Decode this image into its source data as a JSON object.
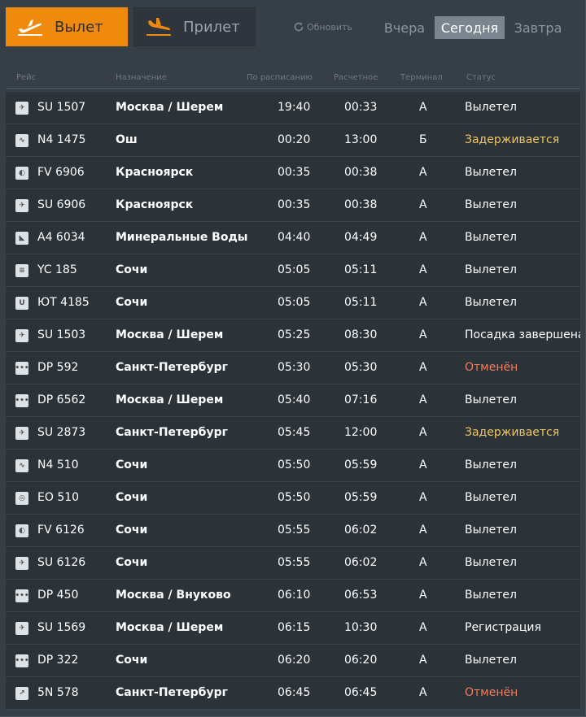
{
  "header": {
    "departures_label": "Вылет",
    "arrivals_label": "Прилет",
    "refresh_label": "Обновить",
    "days": {
      "yesterday": "Вчера",
      "today": "Сегодня",
      "tomorrow": "Завтра"
    }
  },
  "columns": {
    "flight": "Рейс",
    "destination": "Назначение",
    "scheduled": "По расписанию",
    "estimated": "Расчетное",
    "terminal": "Терминал",
    "status": "Статус"
  },
  "colors": {
    "accent": "#f08a0d",
    "delayed": "#f0c75e",
    "cancelled": "#f07e5f",
    "normal": "#ffffff"
  },
  "flights": [
    {
      "airline_icon": "aeroflot-logo-icon",
      "flight": "SU 1507",
      "destination": "Москва / Шерем",
      "scheduled": "19:40",
      "estimated": "00:33",
      "terminal": "A",
      "status": "Вылетел",
      "status_type": "normal"
    },
    {
      "airline_icon": "nordwind-logo-icon",
      "flight": "N4 1475",
      "destination": "Ош",
      "scheduled": "00:20",
      "estimated": "13:00",
      "terminal": "Б",
      "status": "Задерживается",
      "status_type": "delayed"
    },
    {
      "airline_icon": "rossiya-logo-icon",
      "flight": "FV 6906",
      "destination": "Красноярск",
      "scheduled": "00:35",
      "estimated": "00:38",
      "terminal": "A",
      "status": "Вылетел",
      "status_type": "normal"
    },
    {
      "airline_icon": "aeroflot-logo-icon",
      "flight": "SU 6906",
      "destination": "Красноярск",
      "scheduled": "00:35",
      "estimated": "00:38",
      "terminal": "A",
      "status": "Вылетел",
      "status_type": "normal"
    },
    {
      "airline_icon": "aurora-logo-icon",
      "flight": "A4 6034",
      "destination": "Минеральные Воды",
      "scheduled": "04:40",
      "estimated": "04:49",
      "terminal": "A",
      "status": "Вылетел",
      "status_type": "normal"
    },
    {
      "airline_icon": "yamal-logo-icon",
      "flight": "YC 185",
      "destination": "Сочи",
      "scheduled": "05:05",
      "estimated": "05:11",
      "terminal": "A",
      "status": "Вылетел",
      "status_type": "normal"
    },
    {
      "airline_icon": "utair-logo-icon",
      "flight": "ЮТ 4185",
      "destination": "Сочи",
      "scheduled": "05:05",
      "estimated": "05:11",
      "terminal": "A",
      "status": "Вылетел",
      "status_type": "normal"
    },
    {
      "airline_icon": "aeroflot-logo-icon",
      "flight": "SU 1503",
      "destination": "Москва / Шерем",
      "scheduled": "05:25",
      "estimated": "08:30",
      "terminal": "A",
      "status": "Посадка завершена",
      "status_type": "normal"
    },
    {
      "airline_icon": "pobeda-logo-icon",
      "flight": "DP 592",
      "destination": "Санкт-Петербург",
      "scheduled": "05:30",
      "estimated": "05:30",
      "terminal": "A",
      "status": "Отменён",
      "status_type": "cancelled"
    },
    {
      "airline_icon": "pobeda-logo-icon",
      "flight": "DP 6562",
      "destination": "Москва / Шерем",
      "scheduled": "05:40",
      "estimated": "07:16",
      "terminal": "A",
      "status": "Вылетел",
      "status_type": "normal"
    },
    {
      "airline_icon": "aeroflot-logo-icon",
      "flight": "SU 2873",
      "destination": "Санкт-Петербург",
      "scheduled": "05:45",
      "estimated": "12:00",
      "terminal": "A",
      "status": "Задерживается",
      "status_type": "delayed"
    },
    {
      "airline_icon": "nordwind-logo-icon",
      "flight": "N4 510",
      "destination": "Сочи",
      "scheduled": "05:50",
      "estimated": "05:59",
      "terminal": "A",
      "status": "Вылетел",
      "status_type": "normal"
    },
    {
      "airline_icon": "ikar-logo-icon",
      "flight": "EO 510",
      "destination": "Сочи",
      "scheduled": "05:50",
      "estimated": "05:59",
      "terminal": "A",
      "status": "Вылетел",
      "status_type": "normal"
    },
    {
      "airline_icon": "rossiya-logo-icon",
      "flight": "FV 6126",
      "destination": "Сочи",
      "scheduled": "05:55",
      "estimated": "06:02",
      "terminal": "A",
      "status": "Вылетел",
      "status_type": "normal"
    },
    {
      "airline_icon": "aeroflot-logo-icon",
      "flight": "SU 6126",
      "destination": "Сочи",
      "scheduled": "05:55",
      "estimated": "06:02",
      "terminal": "A",
      "status": "Вылетел",
      "status_type": "normal"
    },
    {
      "airline_icon": "pobeda-logo-icon",
      "flight": "DP 450",
      "destination": "Москва / Внуково",
      "scheduled": "06:10",
      "estimated": "06:53",
      "terminal": "A",
      "status": "Вылетел",
      "status_type": "normal"
    },
    {
      "airline_icon": "aeroflot-logo-icon",
      "flight": "SU 1569",
      "destination": "Москва / Шерем",
      "scheduled": "06:15",
      "estimated": "10:30",
      "terminal": "A",
      "status": "Регистрация",
      "status_type": "normal"
    },
    {
      "airline_icon": "pobeda-logo-icon",
      "flight": "DP 322",
      "destination": "Сочи",
      "scheduled": "06:20",
      "estimated": "06:20",
      "terminal": "A",
      "status": "Вылетел",
      "status_type": "normal"
    },
    {
      "airline_icon": "smartavia-logo-icon",
      "flight": "5N 578",
      "destination": "Санкт-Петербург",
      "scheduled": "06:45",
      "estimated": "06:45",
      "terminal": "A",
      "status": "Отменён",
      "status_type": "cancelled"
    }
  ]
}
